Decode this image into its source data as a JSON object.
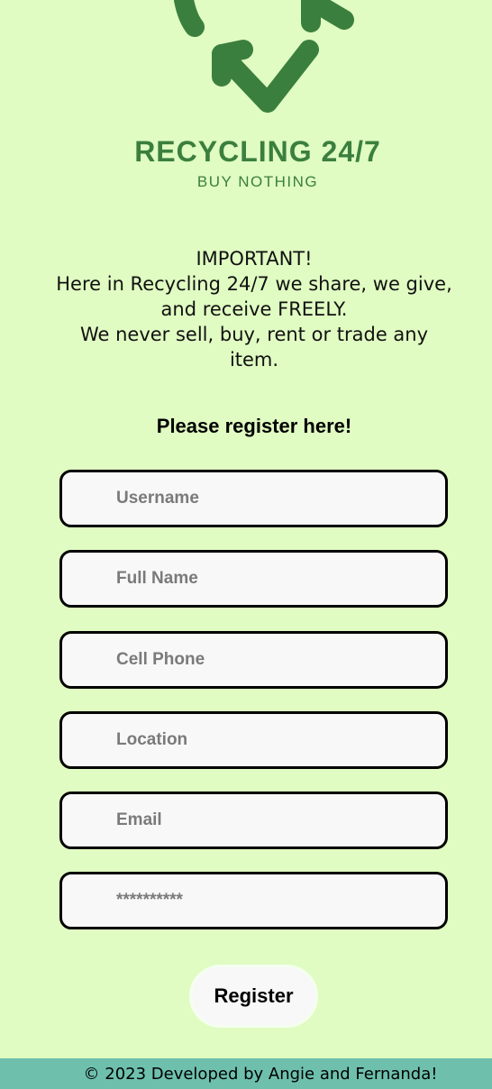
{
  "brand": {
    "title": "RECYCLING 24/7",
    "subtitle": "BUY NOTHING",
    "logo_icon": "recycle-arrows-icon",
    "color": "#3b7f3e"
  },
  "notice": {
    "heading": "IMPORTANT!",
    "line1": "Here in Recycling 24/7 we share, we give, and receive FREELY.",
    "line2": "We never sell, buy, rent or trade any item."
  },
  "form": {
    "heading": "Please register here!",
    "username": {
      "placeholder": "Username"
    },
    "full_name": {
      "placeholder": "Full Name"
    },
    "cell_phone": {
      "placeholder": "Cell Phone"
    },
    "location": {
      "placeholder": "Location"
    },
    "email": {
      "placeholder": "Email"
    },
    "password": {
      "placeholder": "**********"
    },
    "submit_label": "Register"
  },
  "footer": {
    "text": "© 2023 Developed by Angie and Fernanda!"
  },
  "colors": {
    "background": "#e0fcc2",
    "footer": "#6ec0ad",
    "field_border": "#000000",
    "field_fill": "#f8f8f8"
  }
}
